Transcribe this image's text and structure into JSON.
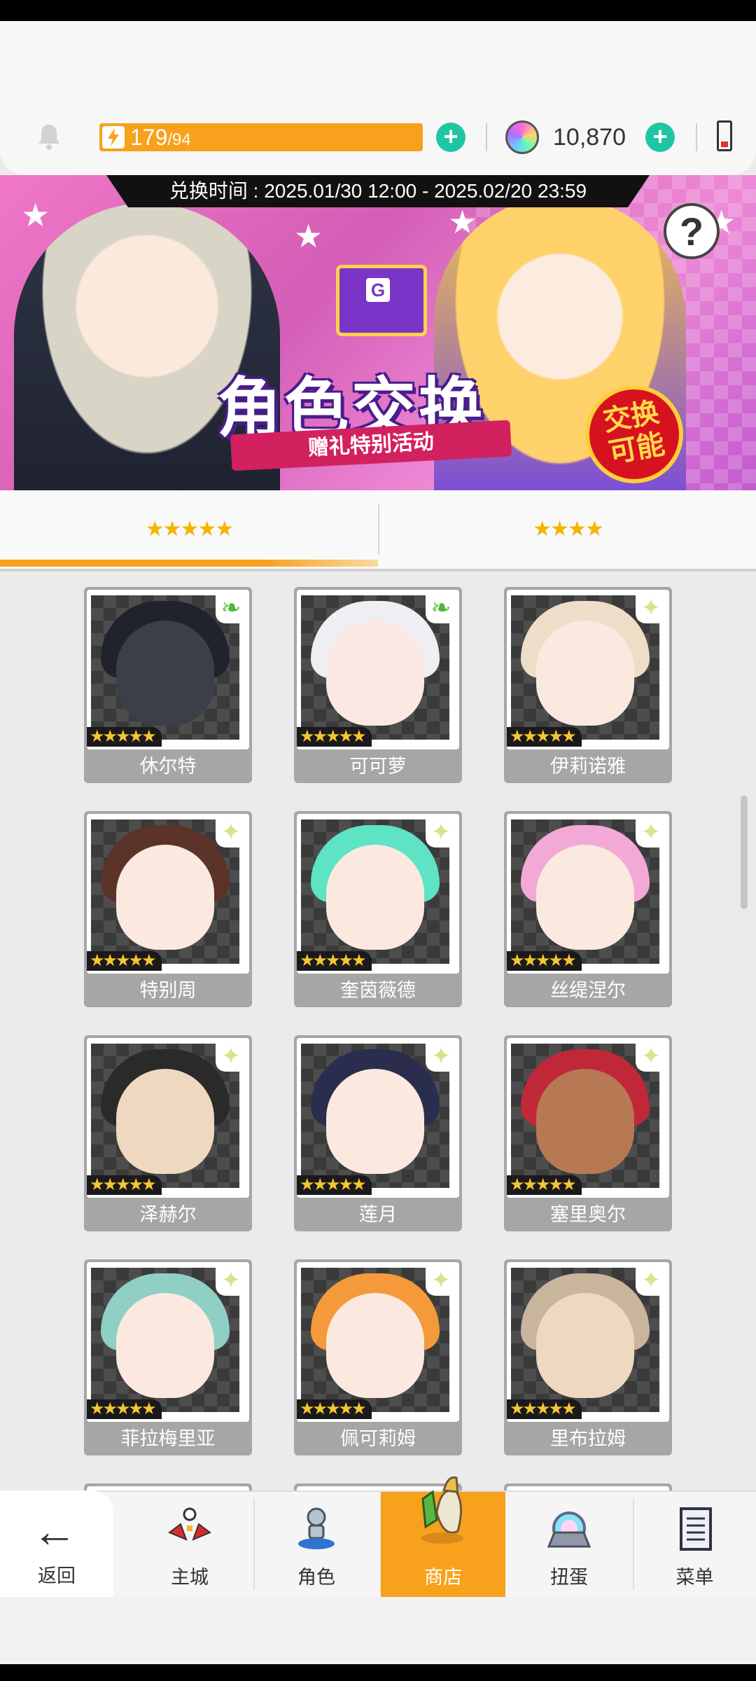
{
  "header": {
    "stamina_value": "179",
    "stamina_max": "/94",
    "gems": "10,870"
  },
  "banner": {
    "period": "兑换时间 : 2025.01/30 12:00 - 2025.02/20 23:59",
    "title": "角色交换",
    "subtitle": "赠礼特别活动",
    "badge": "交换\n可能",
    "envelope_letter": "G",
    "help": "?"
  },
  "tabs": [
    {
      "label": "★★★★★",
      "active": true
    },
    {
      "label": "★★★★",
      "active": false
    }
  ],
  "characters": [
    {
      "name": "休尔特",
      "stars": "★★★★★",
      "element": "leaf",
      "hair": "#20232b",
      "face": "#3b3f48"
    },
    {
      "name": "可可萝",
      "stars": "★★★★★",
      "element": "leaf",
      "hair": "#eeeef3",
      "face": "#fbe8e2"
    },
    {
      "name": "伊莉诺雅",
      "stars": "★★★★★",
      "element": "light",
      "hair": "#efdec7",
      "face": "#fbe9df"
    },
    {
      "name": "特别周",
      "stars": "★★★★★",
      "element": "light",
      "hair": "#5b3328",
      "face": "#fbe9df"
    },
    {
      "name": "奎茵薇德",
      "stars": "★★★★★",
      "element": "light",
      "hair": "#5ee3c4",
      "face": "#fbe9df"
    },
    {
      "name": "丝缇涅尔",
      "stars": "★★★★★",
      "element": "light",
      "hair": "#f3a9d6",
      "face": "#fbe9df"
    },
    {
      "name": "泽赫尔",
      "stars": "★★★★★",
      "element": "light",
      "hair": "#2a2a2a",
      "face": "#efd8c0"
    },
    {
      "name": "莲月",
      "stars": "★★★★★",
      "element": "light",
      "hair": "#2b2d4e",
      "face": "#fbe9df"
    },
    {
      "name": "塞里奥尔",
      "stars": "★★★★★",
      "element": "light",
      "hair": "#c0283a",
      "face": "#b77954"
    },
    {
      "name": "菲拉梅里亚",
      "stars": "★★★★★",
      "element": "light",
      "hair": "#8fcfc4",
      "face": "#fbe9df"
    },
    {
      "name": "佩可莉姆",
      "stars": "★★★★★",
      "element": "light",
      "hair": "#f59a3a",
      "face": "#fbe9df"
    },
    {
      "name": "里布拉姆",
      "stars": "★★★★★",
      "element": "light",
      "hair": "#c9b49c",
      "face": "#efd8c0"
    }
  ],
  "nav": [
    {
      "key": "back",
      "label": "返回"
    },
    {
      "key": "town",
      "label": "主城"
    },
    {
      "key": "characters",
      "label": "角色"
    },
    {
      "key": "shop",
      "label": "商店",
      "active": true
    },
    {
      "key": "gacha",
      "label": "扭蛋"
    },
    {
      "key": "menu",
      "label": "菜单"
    }
  ],
  "colors": {
    "accent": "#f7a11d",
    "plus": "#1fc6a4",
    "card_bg": "#a6a6a6"
  }
}
